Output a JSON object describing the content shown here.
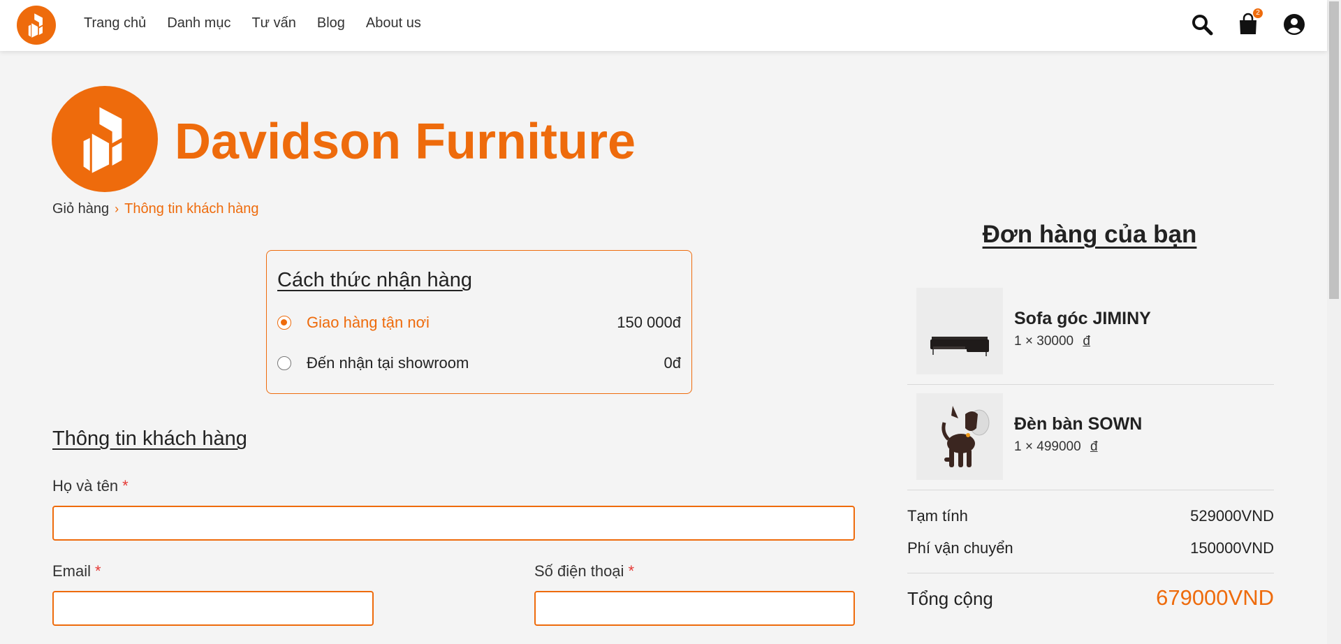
{
  "nav": {
    "links": [
      "Trang chủ",
      "Danh mục",
      "Tư vấn",
      "Blog",
      "About us"
    ],
    "cart_count": "2"
  },
  "brand": {
    "name": "Davidson Furniture"
  },
  "breadcrumb": {
    "parent": "Giỏ hàng",
    "separator": "›",
    "current": "Thông tin khách hàng"
  },
  "delivery": {
    "title": "Cách thức nhận hàng",
    "options": [
      {
        "label": "Giao hàng tận nơi",
        "price": "150 000đ",
        "selected": true
      },
      {
        "label": "Đến nhận tại showroom",
        "price": "0đ",
        "selected": false
      }
    ]
  },
  "customer": {
    "title": "Thông tin khách hàng",
    "fields": {
      "name_label": "Họ và tên",
      "email_label": "Email",
      "phone_label": "Số điện thoại",
      "required_mark": "*",
      "name_value": "",
      "email_value": "",
      "phone_value": ""
    }
  },
  "order": {
    "title": "Đơn hàng của bạn",
    "items": [
      {
        "name": "Sofa góc JIMINY",
        "qty": "1",
        "times": "×",
        "price": "30000",
        "currency": "đ",
        "thumb": "sofa-image"
      },
      {
        "name": "Đèn bàn SOWN",
        "qty": "1",
        "times": "×",
        "price": "499000",
        "currency": "đ",
        "thumb": "dog-lamp-image"
      }
    ],
    "subtotal_label": "Tạm tính",
    "subtotal_value": "529000VND",
    "shipping_label": "Phí vận chuyển",
    "shipping_value": "150000VND",
    "total_label": "Tổng cộng",
    "total_value": "679000VND"
  },
  "colors": {
    "accent": "#ee6b0c",
    "background": "#f4f4f4"
  }
}
